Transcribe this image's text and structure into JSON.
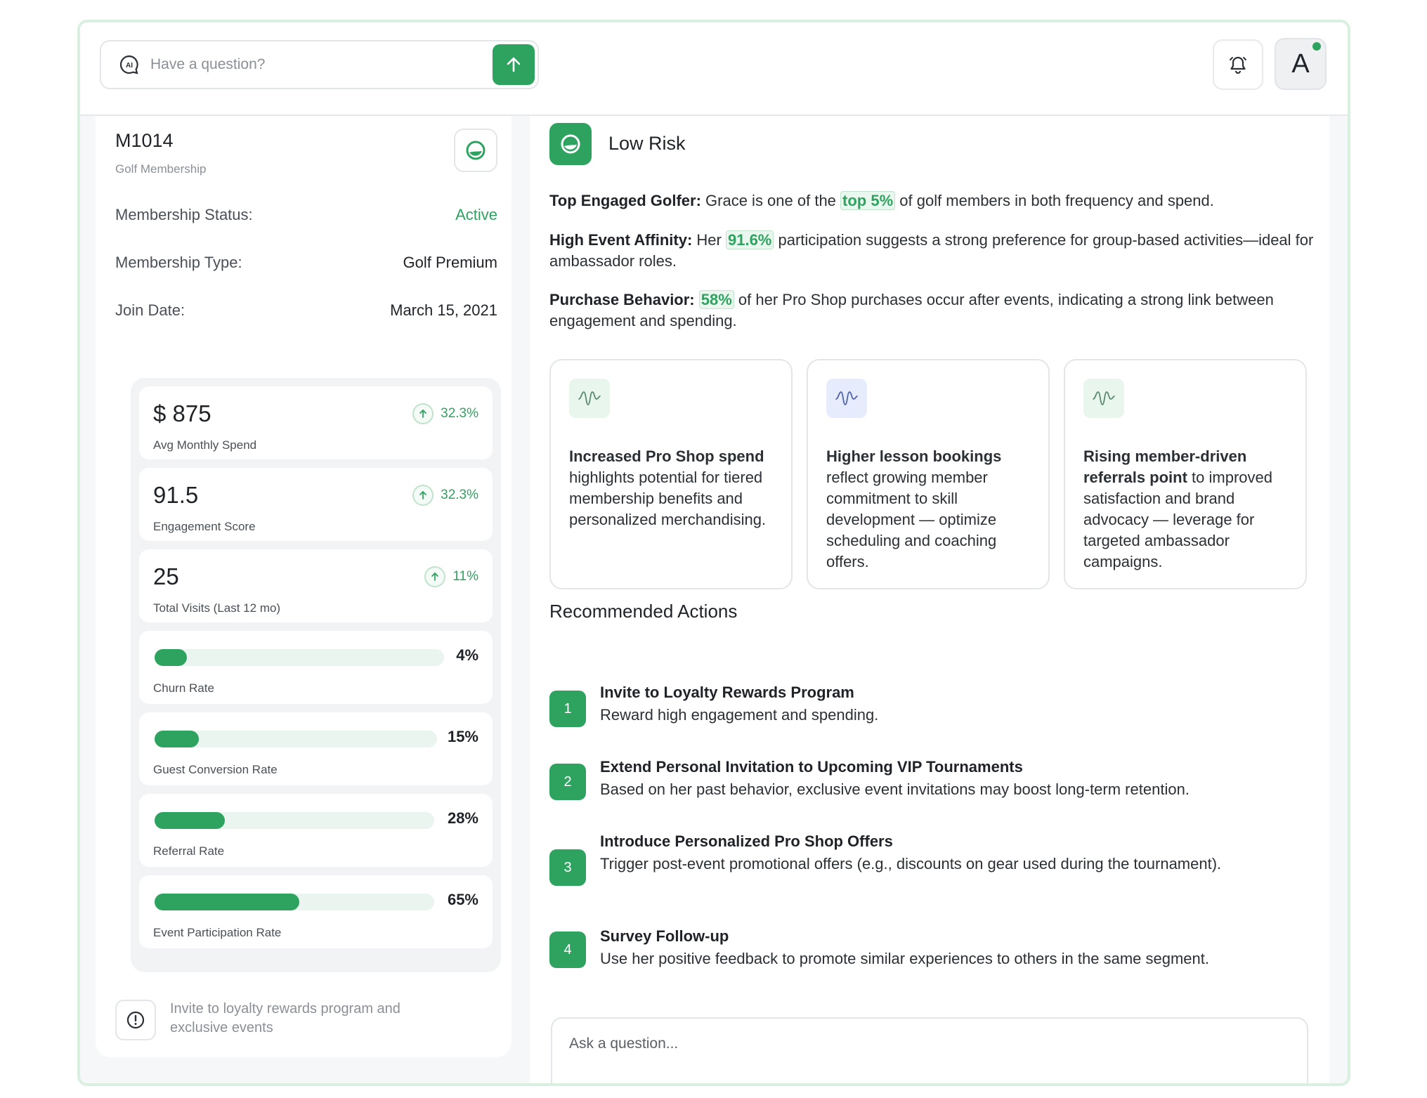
{
  "header": {
    "search_placeholder": "Have a question?",
    "avatar_letter": "A",
    "icons": [
      "ai-chat-icon",
      "arrow-up-icon",
      "bell-icon"
    ]
  },
  "member": {
    "id": "M1014",
    "subtitle": "Golf Membership",
    "rows": [
      {
        "key": "Membership Status:",
        "value": "Active"
      },
      {
        "key": "Membership Type:",
        "value": "Golf Premium"
      },
      {
        "key": "Join Date:",
        "value": "March 15, 2021"
      }
    ],
    "stats": [
      {
        "value": "$ 875",
        "label": "Avg Monthly Spend",
        "trend": "32.3%"
      },
      {
        "value": "91.5",
        "label": "Engagement Score",
        "trend": "32.3%"
      },
      {
        "value": "25",
        "label": "Total Visits (Last 12 mo)",
        "trend": "11%"
      }
    ],
    "rates": [
      {
        "value": "4%",
        "label": "Churn Rate",
        "fraction": 0.04
      },
      {
        "value": "15%",
        "label": "Guest Conversion Rate",
        "fraction": 0.15
      },
      {
        "value": "28%",
        "label": "Referral Rate",
        "fraction": 0.28
      },
      {
        "value": "65%",
        "label": "Event Participation Rate",
        "fraction": 0.65
      }
    ],
    "tip": "Invite to loyalty rewards program and exclusive events"
  },
  "risk": {
    "label": "Low Risk",
    "p1": {
      "bold": "Top Engaged Golfer:",
      "pre": " Grace is one of the ",
      "hl": "top 5%",
      "post": " of golf members in both frequency and spend."
    },
    "p2": {
      "bold": "High Event Affinity:",
      "pre": " Her ",
      "hl": "91.6%",
      "post": " participation suggests a strong preference for group-based activities—ideal for ambassador roles."
    },
    "p3": {
      "bold": "Purchase Behavior:",
      "pre": " ",
      "hl": "58%",
      "post": " of her Pro Shop purchases occur after events, indicating a strong link between engagement and spending."
    }
  },
  "insights": [
    {
      "bold": "Increased Pro Shop spend",
      "rest": " highlights potential for tiered membership benefits and personalized merchandising."
    },
    {
      "bold": "Higher lesson bookings",
      "rest": " reflect growing member commitment to skill development — optimize scheduling and coaching offers."
    },
    {
      "bold": "Rising member-driven referrals point",
      "rest": " to improved satisfaction and brand advocacy — leverage for targeted ambassador campaigns."
    }
  ],
  "recommended": {
    "title": "Recommended Actions",
    "actions": [
      {
        "num": "1",
        "title": "Invite to Loyalty Rewards Program",
        "desc": "Reward high engagement and spending."
      },
      {
        "num": "2",
        "title": "Extend Personal Invitation to Upcoming VIP Tournaments",
        "desc": "Based on her past behavior, exclusive event invitations may boost long-term retention."
      },
      {
        "num": "3",
        "title": "Introduce Personalized Pro Shop Offers",
        "desc": "Trigger post-event promotional offers (e.g., discounts on gear used during the tournament)."
      },
      {
        "num": "4",
        "title": "Survey Follow-up",
        "desc": "Use her positive feedback to promote similar experiences to others in the same segment."
      }
    ]
  },
  "ask_placeholder": "Ask a question...",
  "colors": {
    "accent": "#2ea360",
    "accent_light": "#e9f5ee",
    "insight_badge_blue": "#e6ecfb",
    "insight_badge_green": "#e9f6ee"
  }
}
